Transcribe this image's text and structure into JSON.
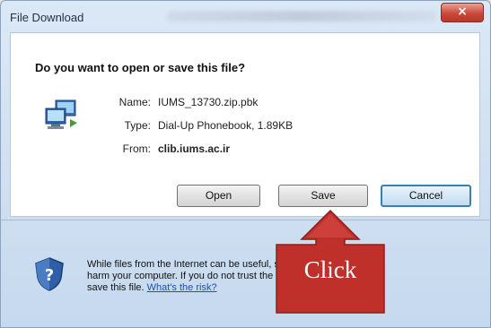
{
  "window": {
    "title": "File Download",
    "close_label": "×"
  },
  "dialog": {
    "question": "Do you want to open or save this file?",
    "file": {
      "name_label": "Name:",
      "name_value": "IUMS_13730.zip.pbk",
      "type_label": "Type:",
      "type_value": "Dial-Up Phonebook, 1.89KB",
      "from_label": "From:",
      "from_value": "clib.iums.ac.ir"
    },
    "buttons": {
      "open": "Open",
      "save": "Save",
      "cancel": "Cancel"
    },
    "warning": {
      "line1": "While files from the Internet can be useful, some files can potentially",
      "line2": "harm your computer. If you do not trust the source, do not open or",
      "line3_prefix": "save this file.",
      "link": "What's the risk?"
    }
  },
  "overlay": {
    "callout_text": "Click",
    "callout_color": "#c0302b"
  },
  "colors": {
    "window_frame": "#c6d9ee",
    "accent_link": "#1a52b8",
    "default_button_border": "#3c7fb1"
  },
  "icons": {
    "file": "computer-network-icon",
    "warning": "shield-question-icon"
  }
}
